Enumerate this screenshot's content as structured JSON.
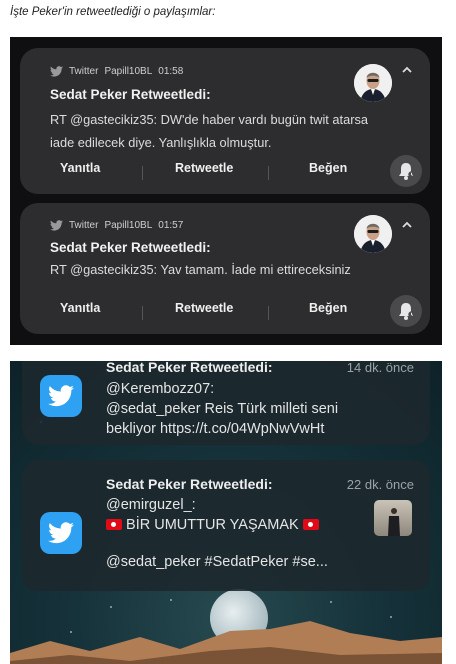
{
  "caption": "İşte Peker'in retweetlediği o paylaşımlar:",
  "top": {
    "cards": [
      {
        "app": "Twitter",
        "account": "Papill10BL",
        "time": "01:58",
        "title": "Sedat Peker Retweetledi:",
        "body": "RT @gastecikiz35: DW'de haber vardı bugün twit atarsa iade edilecek diye. Yanlışlıkla olmuştur.",
        "actions": [
          "Yanıtla",
          "Retweetle",
          "Beğen"
        ]
      },
      {
        "app": "Twitter",
        "account": "Papill10BL",
        "time": "01:57",
        "title": "Sedat Peker Retweetledi:",
        "body": "RT @gastecikiz35: Yav tamam. İade mi ettireceksiniz",
        "actions": [
          "Yanıtla",
          "Retweetle",
          "Beğen"
        ]
      }
    ]
  },
  "bottom": {
    "cards": [
      {
        "title": "Sedat Peker Retweetledi:",
        "time": "14 dk. önce",
        "lines": [
          "@Kerembozz07:",
          "@sedat_peker Reis Türk milleti seni",
          "bekliyor https://t.co/04WpNwVwHt"
        ]
      },
      {
        "title": "Sedat Peker Retweetledi:",
        "time": "22 dk. önce",
        "lines": [
          "@emirguzel_:",
          "BİR UMUTTUR YAŞAMAK",
          "@sedat_peker #SedatPeker #se..."
        ]
      }
    ]
  },
  "colors": {
    "twitter_blue": "#2ea1f2",
    "card_dark": "#2d2d2f",
    "flag_red": "#e30a17"
  },
  "icons": [
    "twitter-bird-icon",
    "chevron-up-icon",
    "bell-snooze-icon",
    "flag-icon"
  ]
}
